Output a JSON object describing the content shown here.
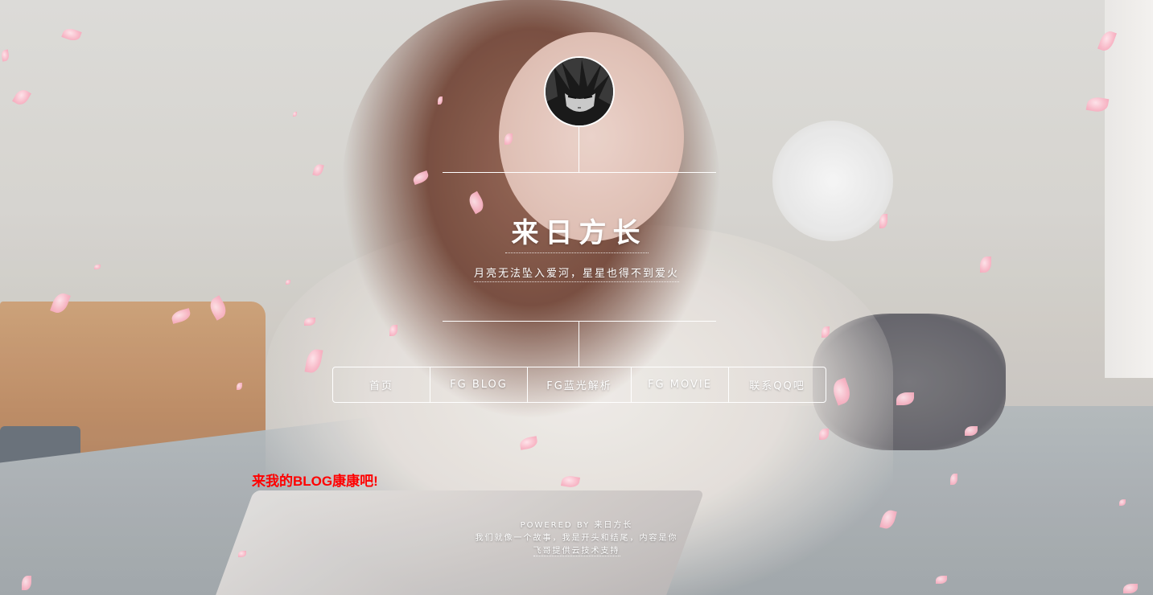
{
  "site": {
    "title": "来日方长",
    "subtitle": "月亮无法坠入爱河，星星也得不到爱火"
  },
  "nav": {
    "items": [
      {
        "label": "首页"
      },
      {
        "label": "FG BLOG"
      },
      {
        "label": "FG蓝光解析"
      },
      {
        "label": "FG MOVIE"
      },
      {
        "label": "联系QQ吧"
      }
    ]
  },
  "promo": {
    "text": "来我的BLOG康康吧!"
  },
  "footer": {
    "powered": "POWERED BY 来日方长",
    "tagline": "我们就像一个故事，我是开头和结尾，内容是你",
    "support": "飞哥提供云技术支持"
  },
  "colors": {
    "promo": "#ff0000",
    "text": "#ffffff",
    "petal": "#f9b6c6"
  },
  "icons": {
    "avatar": "anime-avatar"
  }
}
